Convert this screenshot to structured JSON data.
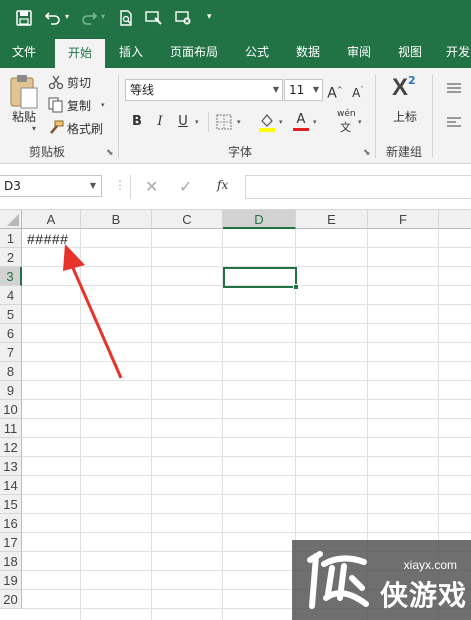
{
  "quick_access": {
    "save_icon": "save-icon",
    "undo_icon": "undo-icon",
    "redo_icon": "redo-icon",
    "print_preview_icon": "print-preview-icon",
    "touch_mode_icon": "touch-mode-icon",
    "more_icon": "customize-icon"
  },
  "tabs": [
    "文件",
    "开始",
    "插入",
    "页面布局",
    "公式",
    "数据",
    "审阅",
    "视图",
    "开发"
  ],
  "active_tab": "开始",
  "ribbon": {
    "clipboard": {
      "paste_label": "粘贴",
      "cut_label": "剪切",
      "copy_label": "复制",
      "format_painter_label": "格式刷",
      "group_label": "剪贴板"
    },
    "font": {
      "font_name": "等线",
      "font_size": "11",
      "bold": "B",
      "italic": "I",
      "underline": "U",
      "font_color_letter": "A",
      "wen_label": "wén",
      "wen_char": "文",
      "group_label": "字体"
    },
    "superscript": {
      "label": "上标",
      "glyph": "X",
      "exponent": "2",
      "group_label": "新建组"
    }
  },
  "formula_bar": {
    "name_box": "D3",
    "fx_label": "fx",
    "content": ""
  },
  "sheet": {
    "columns": [
      "A",
      "B",
      "C",
      "D",
      "E",
      "F"
    ],
    "rows": [
      "1",
      "2",
      "3",
      "4",
      "5",
      "6",
      "7",
      "8",
      "9",
      "10",
      "11",
      "12",
      "13",
      "14",
      "15",
      "16",
      "17",
      "18",
      "19",
      "20"
    ],
    "selected_cell": "D3",
    "cells": {
      "A1": "#####"
    }
  },
  "annotation": {
    "arrow_color": "#e8322c"
  },
  "watermark": {
    "url": "xiayx.com",
    "brand": "侠游戏"
  },
  "colors": {
    "accent": "#217346",
    "ribbon_bg": "#f3f3f3",
    "grid_line": "#e1e1e1"
  }
}
